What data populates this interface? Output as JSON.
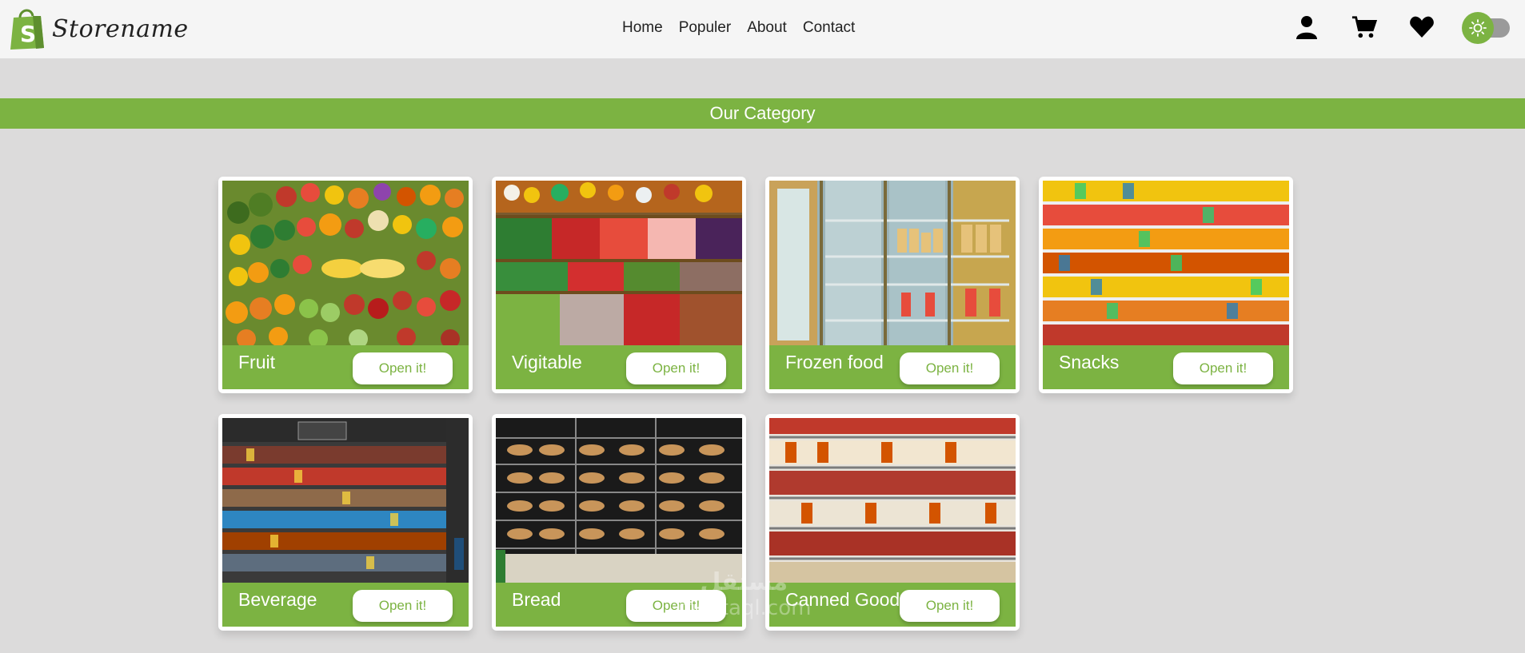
{
  "header": {
    "store_name": "Storename",
    "nav": [
      "Home",
      "Populer",
      "About",
      "Contact"
    ],
    "icons": [
      "user-icon",
      "cart-icon",
      "heart-icon",
      "sun-icon"
    ]
  },
  "banner": {
    "title": "Our Category"
  },
  "categories": [
    {
      "name": "Fruit",
      "button": "Open it!",
      "image": "fruit-photo"
    },
    {
      "name": "Vigitable",
      "button": "Open it!",
      "image": "vegetable-photo"
    },
    {
      "name": "Frozen food",
      "button": "Open it!",
      "image": "frozen-food-photo"
    },
    {
      "name": "Snacks",
      "button": "Open it!",
      "image": "snacks-photo"
    },
    {
      "name": "Beverage",
      "button": "Open it!",
      "image": "beverage-photo"
    },
    {
      "name": "Bread",
      "button": "Open it!",
      "image": "bread-photo"
    },
    {
      "name": "Canned Goods",
      "button": "Open it!",
      "image": "canned-goods-photo"
    }
  ],
  "watermark": {
    "line1": "مستقل",
    "line2": "mostaql.com"
  },
  "colors": {
    "accent": "#7cb342",
    "background": "#dcdbdb",
    "header": "#f5f5f5"
  }
}
